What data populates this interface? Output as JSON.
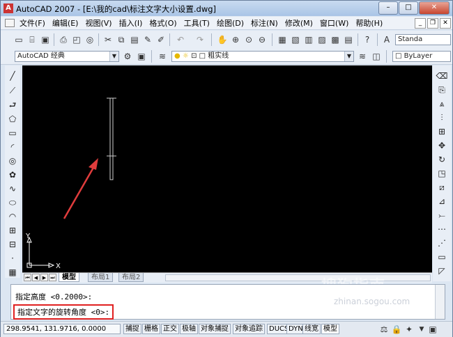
{
  "window": {
    "title": "AutoCAD 2007 - [E:\\我的cad\\标注文字大小设置.dwg]",
    "app_icon": "A",
    "buttons": {
      "minimize": "–",
      "maximize": "□",
      "close": "✕"
    }
  },
  "menubar": {
    "items": [
      "文件(F)",
      "编辑(E)",
      "视图(V)",
      "插入(I)",
      "格式(O)",
      "工具(T)",
      "绘图(D)",
      "标注(N)",
      "修改(M)",
      "窗口(W)",
      "帮助(H)"
    ],
    "doc_buttons": [
      "_",
      "❐",
      "✕"
    ]
  },
  "toolbar": {
    "text_style_combo": "Standa",
    "workspace_combo": "AutoCAD 经典",
    "layer_combo": "粗实线",
    "color_combo": "ByLayer"
  },
  "layout_tabs": [
    "模型",
    "布局1",
    "布局2"
  ],
  "ucs": {
    "x_label": "X",
    "y_label": "Y"
  },
  "command": {
    "history_line": "指定高度 <0.2000>:",
    "current_line": "指定文字的旋转角度 <0>:"
  },
  "status": {
    "coordinates": "298.9541, 131.9716, 0.0000",
    "buttons": [
      "捕捉",
      "栅格",
      "正交",
      "极轴",
      "对象捕捉",
      "对象追踪",
      "DUCS",
      "DYN",
      "线宽",
      "模型"
    ]
  },
  "watermark": {
    "brand": "搜狗指南",
    "url": "zhinan.sogou.com"
  },
  "colors": {
    "canvas": "#000000",
    "arrow": "#e03c3c",
    "highlight": "#e02020"
  }
}
